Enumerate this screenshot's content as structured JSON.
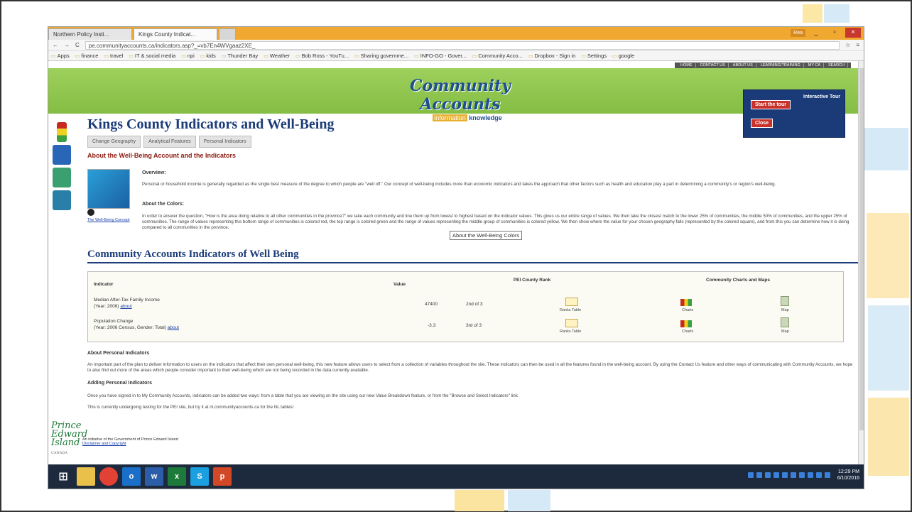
{
  "browser": {
    "tabs": [
      "Northern Policy Insti...",
      "Kings County Indicat...",
      ""
    ],
    "url": "pe.communityaccounts.ca/indicators.asp?_=vb7En4WVgaaz2XE_",
    "user": "Rea",
    "bookmarks": [
      "Apps",
      "finance",
      "travel",
      "IT & social media",
      "npi",
      "kids",
      "Thunder Bay",
      "Weather",
      "Bob Ross - YouTu...",
      "Sharing governme...",
      "INFO-GO - Gover...",
      "Community Acco...",
      "Dropbox - Sign in",
      "Settings",
      "google"
    ]
  },
  "topnav": [
    "HOME",
    "CONTACT US",
    "ABOUT US",
    "LEARNING/TRAINING",
    "MY CA",
    "SEARCH"
  ],
  "logo": {
    "main": "Community Accounts",
    "data": "data",
    "info": "information",
    "know": "knowledge"
  },
  "tour": {
    "title": "Interactive Tour",
    "start": "Start the tour",
    "close": "Close"
  },
  "page": {
    "title": "Kings County Indicators and Well-Being",
    "subtabs": [
      "Change Geography",
      "Analytical Features",
      "Personal Indicators"
    ],
    "section_title": "About the Well-Being Account and the Indicators",
    "overview_h": "Overview:",
    "overview": "Personal or household income is generally regarded as the single best measure of the degree to which people are \"well off.\" Our concept of well-being includes more than economic indicators and takes the approach that other factors such as health and education play a part in determining a community's or region's well-being.",
    "colors_h": "About the Colors:",
    "colors": "In order to answer the question, \"How is the area doing relative to all other communities in the province?\" we take each community and line them up from lowest to highest based on the indicator values. This gives us our entire range of values. We then take the closest match to the lower 25% of communities, the middle 50% of communities, and the upper 25% of communities. The range of values representing this bottom range of communities is colored red, the top range is colored green and the range of values representing the middle group of communities is colored yellow. We then show where the value for your chosen geography falls (represented by the colored square), and from this you can determine how it is doing compared to all communities in the province.",
    "wb_link": "The Well-Being Concept",
    "tooltip": "About the Well-Being Colors",
    "cai_title": "Community Accounts Indicators of Well Being",
    "table": {
      "h_indicator": "Indicator",
      "h_value": "Value",
      "h_rank": "PEI County Rank",
      "h_charts": "Community Charts and Maps",
      "rows": [
        {
          "name": "Median After-Tax Family Income",
          "meta": "(Year: 2006)",
          "about": "about",
          "value": "47400",
          "rank": "2nd of 3",
          "ranks": "Ranks Table",
          "charts": "Charts",
          "map": "Map"
        },
        {
          "name": "Population Change",
          "meta": "(Year: 2006 Census, Gender: Total)",
          "about": "about",
          "value": "-3.3",
          "rank": "3rd of 3",
          "ranks": "Ranks Table",
          "charts": "Charts",
          "map": "Map"
        }
      ]
    },
    "about_pi_h": "About Personal Indicators",
    "about_pi": "An important part of the plan to deliver information to users on the indicators that affect their own personal well-being, this new feature allows users to select from a collection of variables throughout the site. These indicators can then be used in all the features found in the well-being account. By using the Contact Us feature and other ways of communicating with Community Accounts, we hope to also find out more of the areas which people consider important to their well-being which are not being recorded in the data currently available.",
    "adding_h": "Adding Personal Indicators",
    "adding": "Once you have signed in to My Community Accounts, indicators can be added two ways: from a table that you are viewing on the site using our new Value Breakdown feature, or from the \"Browse and Select Indicators\" link.",
    "testing": "This is currently undergoing testing for the PEI site, but try it at nl.communityaccounts.ca for the NL tables!",
    "pei_logo": "Prince Edward Island",
    "pei_canada": "CANADA",
    "pei_initiative": "An initiative of the Government of Prince Edward Island",
    "disclaimer": "Disclaimer and Copyright"
  },
  "taskbar": {
    "clock_time": "12:29 PM",
    "clock_date": "6/10/2016"
  }
}
